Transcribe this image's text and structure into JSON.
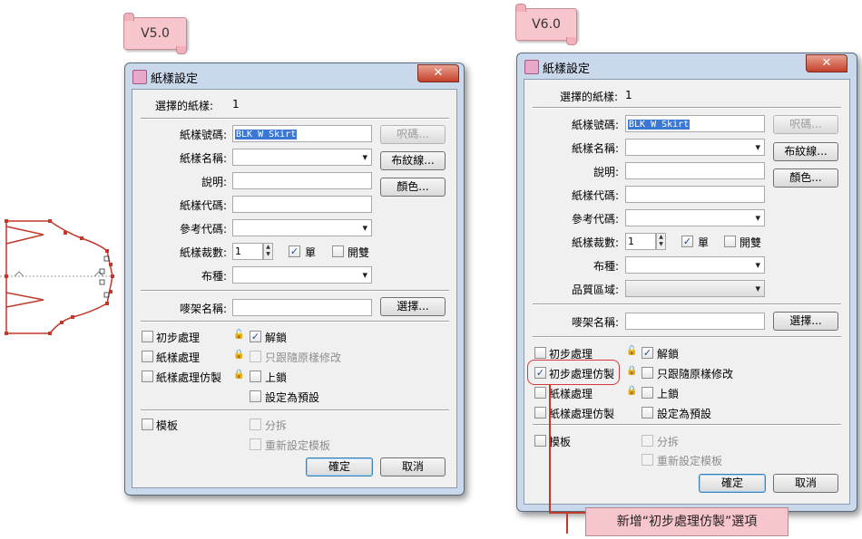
{
  "tags": {
    "v5": "V5.0",
    "v6": "V6.0"
  },
  "window": {
    "title": "紙樣設定",
    "close": "✕"
  },
  "labels": {
    "selected": "選擇的紙樣:",
    "selected_count": "1",
    "piece_number": "紙樣號碼:",
    "piece_name": "紙樣名稱:",
    "description": "說明:",
    "piece_code": "紙樣代碼:",
    "ref_code": "參考代碼:",
    "cut_qty": "紙樣裁數:",
    "fabric": "布種:",
    "quality_zone": "品質區域:",
    "rack_name": "嘜架名稱:"
  },
  "values": {
    "piece_number": "BLK W Skirt",
    "cut_qty": "1"
  },
  "buttons": {
    "size": "呎碼...",
    "grain": "布紋線...",
    "color": "顏色...",
    "select": "選擇...",
    "ok": "確定",
    "cancel": "取消"
  },
  "checks": {
    "single": "單",
    "split": "開雙",
    "initial": "初步處理",
    "initial_copy": "初步處理仿製",
    "piece_proc": "紙樣處理",
    "piece_proc_copy": "紙樣處理仿製",
    "unlock": "解鎖",
    "follow_orig": "只跟隨原樣修改",
    "lock": "上鎖",
    "set_default": "設定為預設",
    "template": "模板",
    "split2": "分拆",
    "reset_template": "重新設定模板"
  },
  "checked_mark": "✓",
  "lock_icons": {
    "unlocked": "🔓",
    "follow": "🔒",
    "locked": "🔒"
  },
  "annotation": "新增“初步處理仿製”選項"
}
